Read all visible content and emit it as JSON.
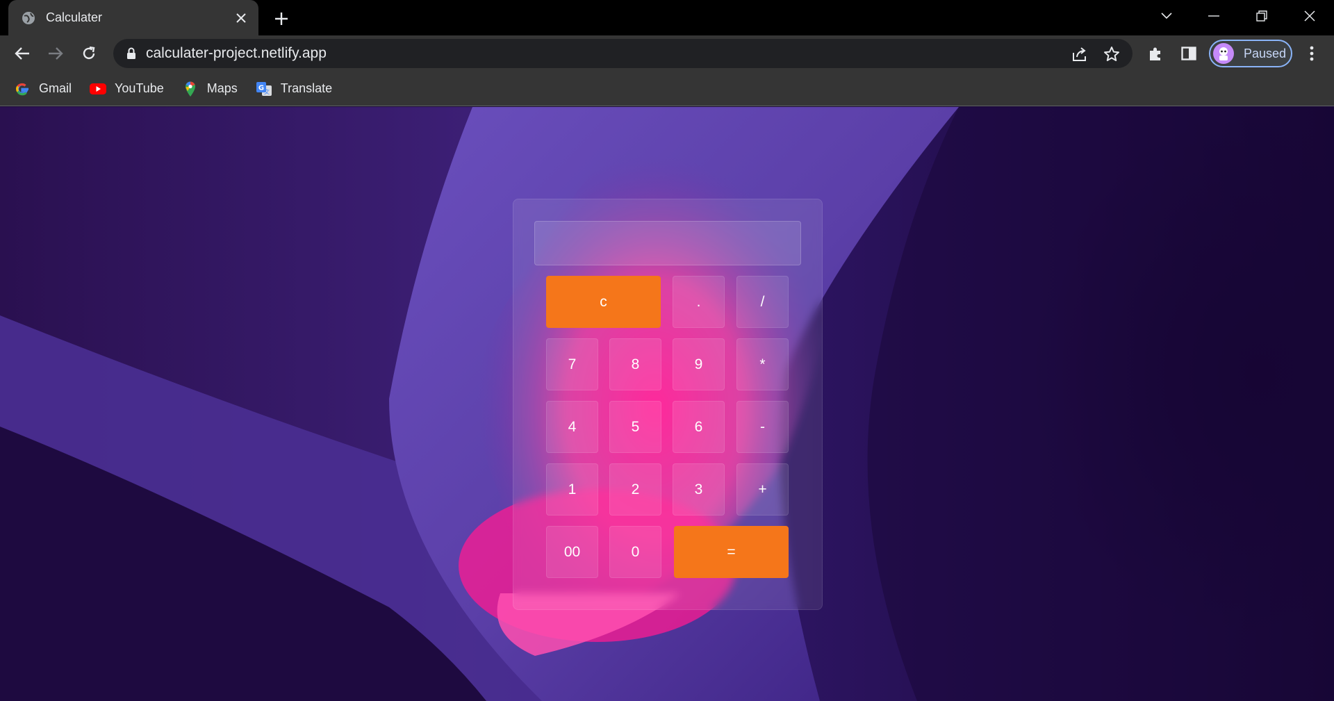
{
  "browser": {
    "tab_title": "Calculater",
    "url": "calculater-project.netlify.app",
    "profile_label": "Paused",
    "bookmarks": [
      {
        "label": "Gmail",
        "icon": "google-icon"
      },
      {
        "label": "YouTube",
        "icon": "youtube-icon"
      },
      {
        "label": "Maps",
        "icon": "maps-icon"
      },
      {
        "label": "Translate",
        "icon": "translate-icon"
      }
    ]
  },
  "calculator": {
    "display_value": "",
    "keys": {
      "clear": "c",
      "dot": ".",
      "divide": "/",
      "seven": "7",
      "eight": "8",
      "nine": "9",
      "multiply": "*",
      "four": "4",
      "five": "5",
      "six": "6",
      "minus": "-",
      "one": "1",
      "two": "2",
      "three": "3",
      "plus": "+",
      "double_zero": "00",
      "zero": "0",
      "equals": "="
    }
  },
  "colors": {
    "accent_orange": "#f5761a",
    "background_dark": "#1b0838",
    "background_pink": "#ff1e90",
    "background_purple": "#5b3fa8"
  }
}
